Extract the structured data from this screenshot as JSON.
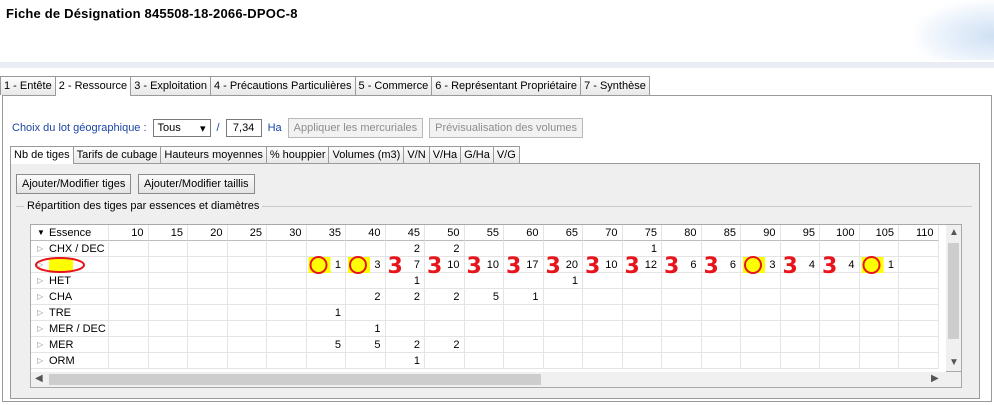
{
  "window": {
    "title": "Fiche de Désignation 845508-18-2066-DPOC-8"
  },
  "main_tabs": [
    {
      "label": "1 - Entête",
      "active": false
    },
    {
      "label": "2 - Ressource",
      "active": true
    },
    {
      "label": "3 - Exploitation",
      "active": false
    },
    {
      "label": "4 - Précautions Particulières",
      "active": false
    },
    {
      "label": "5 - Commerce",
      "active": false
    },
    {
      "label": "6 - Représentant Propriétaire",
      "active": false
    },
    {
      "label": "7 - Synthèse",
      "active": false
    }
  ],
  "lot": {
    "label": "Choix du lot géographique :",
    "selected": "Tous",
    "separator": "/",
    "area": "7,34",
    "unit": "Ha",
    "apply_button": "Appliquer les mercuriales",
    "preview_button": "Prévisualisation des volumes"
  },
  "sub_tabs": [
    {
      "label": "Nb de tiges",
      "active": true
    },
    {
      "label": "Tarifs de cubage",
      "active": false
    },
    {
      "label": "Hauteurs moyennes",
      "active": false
    },
    {
      "label": "% houppier",
      "active": false
    },
    {
      "label": "Volumes (m3)",
      "active": false
    },
    {
      "label": "V/N",
      "active": false
    },
    {
      "label": "V/Ha",
      "active": false
    },
    {
      "label": "G/Ha",
      "active": false
    },
    {
      "label": "V/G",
      "active": false
    }
  ],
  "actions": {
    "add_tiges": "Ajouter/Modifier tiges",
    "add_taillis": "Ajouter/Modifier taillis"
  },
  "group_label": "Répartition des tiges par essences et diamètres",
  "grid": {
    "essence_header": "Essence",
    "diameters": [
      "10",
      "15",
      "20",
      "25",
      "30",
      "35",
      "40",
      "45",
      "50",
      "55",
      "60",
      "65",
      "70",
      "75",
      "80",
      "85",
      "90",
      "95",
      "100",
      "105",
      "110"
    ],
    "rows": [
      {
        "name": "CHX / DEC",
        "values": [
          "",
          "",
          "",
          "",
          "",
          "",
          "",
          "2",
          "2",
          "",
          "",
          "",
          "",
          "1",
          "",
          "",
          "",
          "",
          "",
          "",
          ""
        ]
      },
      {
        "name": "CHX",
        "values": [
          "",
          "",
          "",
          "",
          "",
          "1",
          "3",
          "7",
          "10",
          "10",
          "17",
          "20",
          "10",
          "12",
          "6",
          "6",
          "3",
          "4",
          "4",
          "1",
          ""
        ]
      },
      {
        "name": "HET",
        "values": [
          "",
          "",
          "",
          "",
          "",
          "",
          "",
          "1",
          "",
          "",
          "",
          "1",
          "",
          "",
          "",
          "",
          "",
          "",
          "",
          "",
          ""
        ]
      },
      {
        "name": "CHA",
        "values": [
          "",
          "",
          "",
          "",
          "",
          "",
          "2",
          "2",
          "2",
          "5",
          "1",
          "",
          "",
          "",
          "",
          "",
          "",
          "",
          "",
          "",
          ""
        ]
      },
      {
        "name": "TRE",
        "values": [
          "",
          "",
          "",
          "",
          "",
          "1",
          "",
          "",
          "",
          "",
          "",
          "",
          "",
          "",
          "",
          "",
          "",
          "",
          "",
          "",
          ""
        ]
      },
      {
        "name": "MER / DEC",
        "values": [
          "",
          "",
          "",
          "",
          "",
          "",
          "1",
          "",
          "",
          "",
          "",
          "",
          "",
          "",
          "",
          "",
          "",
          "",
          "",
          "",
          ""
        ]
      },
      {
        "name": "MER",
        "values": [
          "",
          "",
          "",
          "",
          "",
          "5",
          "5",
          "2",
          "2",
          "",
          "",
          "",
          "",
          "",
          "",
          "",
          "",
          "",
          "",
          "",
          ""
        ]
      },
      {
        "name": "ORM",
        "values": [
          "",
          "",
          "",
          "",
          "",
          "",
          "",
          "1",
          "",
          "",
          "",
          "",
          "",
          "",
          "",
          "",
          "",
          "",
          "",
          "",
          ""
        ]
      }
    ]
  },
  "annotations": {
    "handwritten_digit": "3",
    "highlight_color": "#ffff00",
    "ink_color": "#e8141c"
  },
  "icons": {
    "select_arrow": "chevron-down-icon",
    "expanded": "triangle-down-icon",
    "collapsed": "triangle-right-icon"
  }
}
